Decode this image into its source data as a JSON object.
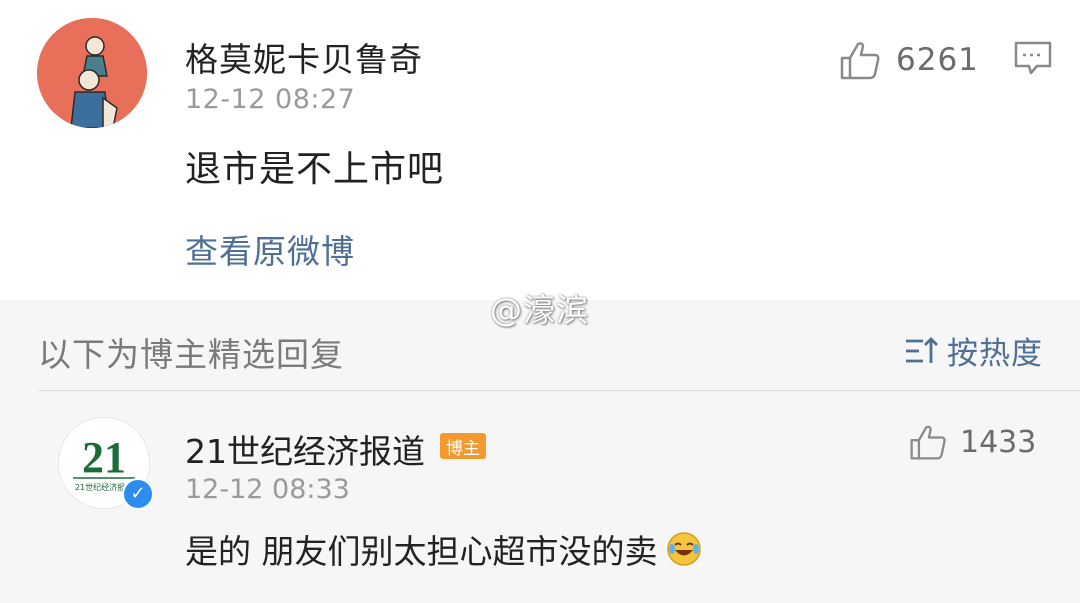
{
  "comment": {
    "username": "格莫妮卡贝鲁奇",
    "timestamp": "12-12 08:27",
    "text": "退市是不上市吧",
    "view_original": "查看原微博",
    "like_count": "6261",
    "avatar_icon": "cartoon-people-avatar",
    "like_icon": "thumbs-up-icon",
    "reply_icon": "comment-bubble-icon"
  },
  "watermark": "@濠滨",
  "section": {
    "title": "以下为博主精选回复",
    "sort_label": "按热度",
    "sort_icon": "sort-icon"
  },
  "reply": {
    "username": "21世纪经济报道",
    "badge": "博主",
    "timestamp": "12-12 08:33",
    "text": "是的 朋友们别太担心超市没的卖",
    "like_count": "1433",
    "avatar_text": "21",
    "avatar_subtext": "21世纪经济报道",
    "verified_icon": "verified-v-icon",
    "emoji_icon": "laughing-crying-emoji"
  },
  "colors": {
    "link": "#4f6f95",
    "badge": "#f39a2f",
    "avatar_bg": "#e8705a",
    "verified": "#2d8cf0"
  }
}
